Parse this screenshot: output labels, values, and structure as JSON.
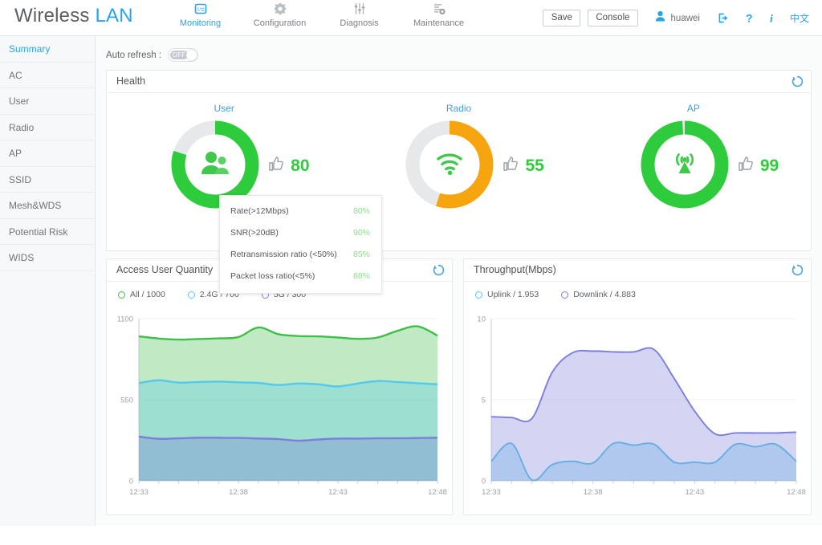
{
  "header": {
    "brand_prefix": "Wireless",
    "brand_suffix": "LAN",
    "nav": [
      {
        "label": "Monitoring",
        "icon": "monitoring-icon",
        "active": true
      },
      {
        "label": "Configuration",
        "icon": "gear-icon",
        "active": false
      },
      {
        "label": "Diagnosis",
        "icon": "sliders-icon",
        "active": false
      },
      {
        "label": "Maintenance",
        "icon": "maintenance-icon",
        "active": false
      }
    ],
    "save_label": "Save",
    "console_label": "Console",
    "username": "huawei",
    "logout_icon": "logout-icon",
    "help_icon": "question-icon",
    "info_icon": "info-icon",
    "language_label": "中文",
    "accent_color": "#2aa3e8"
  },
  "sidebar": {
    "items": [
      {
        "label": "Summary",
        "active": true
      },
      {
        "label": "AC",
        "active": false
      },
      {
        "label": "User",
        "active": false
      },
      {
        "label": "Radio",
        "active": false
      },
      {
        "label": "AP",
        "active": false
      },
      {
        "label": "SSID",
        "active": false
      },
      {
        "label": "Mesh&WDS",
        "active": false
      },
      {
        "label": "Potential Risk",
        "active": false
      },
      {
        "label": "WIDS",
        "active": false
      }
    ]
  },
  "toolbar": {
    "auto_refresh_label": "Auto refresh :",
    "auto_refresh_state": "OFF"
  },
  "health": {
    "title": "Health",
    "refresh_icon": "refresh-icon",
    "gauges": [
      {
        "label": "User",
        "value": 80,
        "score": "80",
        "color": "#2ecb3c",
        "icon": "users-icon"
      },
      {
        "label": "Radio",
        "value": 55,
        "score": "55",
        "color": "#f6a50f",
        "icon": "wifi-icon"
      },
      {
        "label": "AP",
        "value": 99,
        "score": "99",
        "color": "#2ecb3c",
        "icon": "antenna-icon"
      }
    ]
  },
  "tooltip": {
    "rows": [
      {
        "key": "Rate(>12Mbps)",
        "value": "80%"
      },
      {
        "key": "SNR(>20dB)",
        "value": "90%"
      },
      {
        "key": "Retransmission ratio (<50%)",
        "value": "85%"
      },
      {
        "key": "Packet loss ratio(<5%)",
        "value": "88%"
      }
    ]
  },
  "access_user_quantity": {
    "title": "Access User Quantity",
    "refresh_icon": "refresh-icon"
  },
  "throughput": {
    "title": "Throughput(Mbps)",
    "refresh_icon": "refresh-icon"
  },
  "chart_data": [
    {
      "type": "area",
      "title": "Access User Quantity",
      "xlabel": "",
      "ylabel": "",
      "ylim": [
        0,
        1100
      ],
      "yticks": [
        0,
        550,
        1100
      ],
      "ytick_labels": [
        "0",
        "550",
        "1100"
      ],
      "x": [
        "12:33",
        "12:34",
        "12:35",
        "12:36",
        "12:37",
        "12:38",
        "12:39",
        "12:40",
        "12:41",
        "12:42",
        "12:43",
        "12:44",
        "12:45",
        "12:46",
        "12:47",
        "12:48"
      ],
      "xtick_labels": [
        "12:33",
        "12:38",
        "12:43",
        "12:48"
      ],
      "grid": true,
      "legend": [
        {
          "label": "All / 1000",
          "color": "#3fbf4a"
        },
        {
          "label": "2.4G / 700",
          "color": "#55c8ee"
        },
        {
          "label": "5G / 300",
          "color": "#7d7ddb"
        }
      ],
      "series": [
        {
          "name": "All / 1000",
          "color": "#3fbf4a",
          "values": [
            980,
            965,
            958,
            962,
            966,
            975,
            1040,
            995,
            982,
            980,
            972,
            963,
            972,
            1018,
            1048,
            985
          ]
        },
        {
          "name": "2.4G / 700",
          "color": "#55c8ee",
          "values": [
            663,
            682,
            666,
            670,
            673,
            668,
            664,
            650,
            660,
            655,
            640,
            660,
            677,
            670,
            662,
            655
          ]
        },
        {
          "name": "5G / 300",
          "color": "#7d7ddb",
          "values": [
            300,
            285,
            288,
            292,
            292,
            291,
            287,
            283,
            272,
            280,
            286,
            286,
            288,
            288,
            290,
            292
          ]
        }
      ]
    },
    {
      "type": "area",
      "title": "Throughput(Mbps)",
      "xlabel": "",
      "ylabel": "Mbps",
      "ylim": [
        0,
        10
      ],
      "yticks": [
        0,
        5,
        10
      ],
      "ytick_labels": [
        "0",
        "5",
        "10"
      ],
      "x": [
        "12:33",
        "12:34",
        "12:35",
        "12:36",
        "12:37",
        "12:38",
        "12:39",
        "12:40",
        "12:41",
        "12:42",
        "12:43",
        "12:44",
        "12:45",
        "12:46",
        "12:47",
        "12:48"
      ],
      "xtick_labels": [
        "12:33",
        "12:38",
        "12:43",
        "12:48"
      ],
      "grid": true,
      "legend": [
        {
          "label": "Uplink / 1.953",
          "color": "#5bc8e8"
        },
        {
          "label": "Downlink / 4.883",
          "color": "#7d7ddb"
        }
      ],
      "series": [
        {
          "name": "Uplink / 1.953",
          "color": "#5bc8e8",
          "values": [
            1.2,
            2.3,
            0.05,
            1.0,
            1.2,
            1.1,
            2.3,
            2.2,
            2.25,
            1.15,
            1.15,
            1.15,
            2.25,
            2.1,
            2.25,
            1.2
          ]
        },
        {
          "name": "Downlink / 4.883",
          "color": "#7d7ddb",
          "values": [
            3.95,
            3.9,
            3.85,
            6.7,
            7.9,
            8.0,
            7.95,
            7.95,
            8.1,
            6.3,
            4.3,
            2.9,
            2.95,
            2.95,
            2.95,
            3.0
          ]
        }
      ]
    }
  ]
}
